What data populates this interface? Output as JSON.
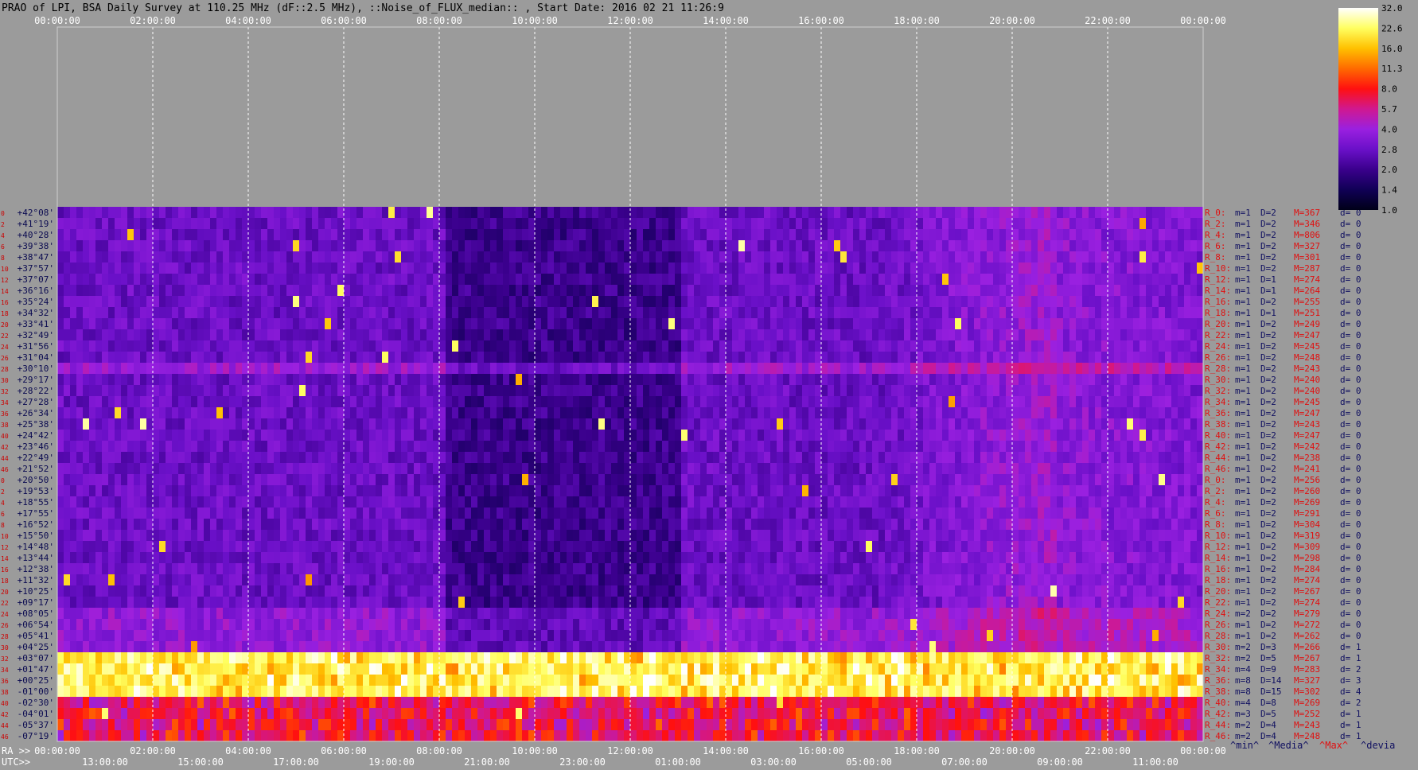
{
  "title": "PRAO of LPI, BSA Daily Survey at 110.25 MHz (dF::2.5 MHz), ::Noise_of_FLUX_median:: , Start Date: 2016 02 21 11:26:9",
  "colors": {
    "background": "#9b9b9b",
    "title_text": "#000000",
    "top_tick_text": "#ffffff",
    "dec_label_text": "#0a0a50",
    "row_index_text": "#cc0000",
    "stat_R": "#e01010",
    "stat_mD": "#101060",
    "stat_M": "#e01010",
    "stat_d": "#101060"
  },
  "chart_data": {
    "type": "heatmap",
    "title": "PRAO of LPI, BSA Daily Survey at 110.25 MHz (dF::2.5 MHz), ::Noise_of_FLUX_median:: , Start Date: 2016 02 21 11:26:9",
    "top_axis_ticks": [
      "00:00:00",
      "02:00:00",
      "04:00:00",
      "06:00:00",
      "08:00:00",
      "10:00:00",
      "12:00:00",
      "14:00:00",
      "16:00:00",
      "18:00:00",
      "20:00:00",
      "22:00:00",
      "00:00:00"
    ],
    "ra_axis_label": "RA >>",
    "ra_ticks": [
      "00:00:00",
      "02:00:00",
      "04:00:00",
      "06:00:00",
      "08:00:00",
      "10:00:00",
      "12:00:00",
      "14:00:00",
      "16:00:00",
      "18:00:00",
      "20:00:00",
      "22:00:00",
      "00:00:00"
    ],
    "utc_axis_label": "UTC>>",
    "utc_ticks": [
      "13:00:00",
      "15:00:00",
      "17:00:00",
      "19:00:00",
      "21:00:00",
      "23:00:00",
      "01:00:00",
      "03:00:00",
      "05:00:00",
      "07:00:00",
      "09:00:00",
      "11:00:00"
    ],
    "y_labels": [
      "+42°08'",
      "+41°19'",
      "+40°28'",
      "+39°38'",
      "+38°47'",
      "+37°57'",
      "+37°07'",
      "+36°16'",
      "+35°24'",
      "+34°32'",
      "+33°41'",
      "+32°49'",
      "+31°56'",
      "+31°04'",
      "+30°10'",
      "+29°17'",
      "+28°22'",
      "+27°28'",
      "+26°34'",
      "+25°38'",
      "+24°42'",
      "+23°46'",
      "+22°49'",
      "+21°52'",
      "+20°50'",
      "+19°53'",
      "+18°55'",
      "+17°55'",
      "+16°52'",
      "+15°50'",
      "+14°48'",
      "+13°44'",
      "+12°38'",
      "+11°32'",
      "+10°25'",
      "+09°17'",
      "+08°05'",
      "+06°54'",
      "+05°41'",
      "+04°25'",
      "+03°07'",
      "+01°47'",
      "+00°25'",
      "-01°00'",
      "-02°30'",
      "-04°01'",
      "-05°37'",
      "-07°19'"
    ],
    "row_indices": [
      "0",
      "2",
      "4",
      "6",
      "8",
      "10",
      "12",
      "14",
      "16",
      "18",
      "20",
      "22",
      "24",
      "26",
      "28",
      "30",
      "32",
      "34",
      "36",
      "38",
      "40",
      "42",
      "44",
      "46",
      "0",
      "2",
      "4",
      "6",
      "8",
      "10",
      "12",
      "14",
      "16",
      "18",
      "20",
      "22",
      "24",
      "26",
      "28",
      "30",
      "32",
      "34",
      "36",
      "38",
      "40",
      "42",
      "44",
      "46"
    ],
    "row_stats": [
      {
        "r": "R_0:",
        "m": "m=1",
        "D": "D=2",
        "M": "M=367",
        "d": "d= 0"
      },
      {
        "r": "R_2:",
        "m": "m=1",
        "D": "D=2",
        "M": "M=346",
        "d": "d= 0"
      },
      {
        "r": "R_4:",
        "m": "m=1",
        "D": "D=2",
        "M": "M=806",
        "d": "d= 0"
      },
      {
        "r": "R_6:",
        "m": "m=1",
        "D": "D=2",
        "M": "M=327",
        "d": "d= 0"
      },
      {
        "r": "R_8:",
        "m": "m=1",
        "D": "D=2",
        "M": "M=301",
        "d": "d= 0"
      },
      {
        "r": "R_10:",
        "m": "m=1",
        "D": "D=2",
        "M": "M=287",
        "d": "d= 0"
      },
      {
        "r": "R_12:",
        "m": "m=1",
        "D": "D=1",
        "M": "M=274",
        "d": "d= 0"
      },
      {
        "r": "R_14:",
        "m": "m=1",
        "D": "D=1",
        "M": "M=264",
        "d": "d= 0"
      },
      {
        "r": "R_16:",
        "m": "m=1",
        "D": "D=2",
        "M": "M=255",
        "d": "d= 0"
      },
      {
        "r": "R_18:",
        "m": "m=1",
        "D": "D=1",
        "M": "M=251",
        "d": "d= 0"
      },
      {
        "r": "R_20:",
        "m": "m=1",
        "D": "D=2",
        "M": "M=249",
        "d": "d= 0"
      },
      {
        "r": "R_22:",
        "m": "m=1",
        "D": "D=2",
        "M": "M=247",
        "d": "d= 0"
      },
      {
        "r": "R_24:",
        "m": "m=1",
        "D": "D=2",
        "M": "M=245",
        "d": "d= 0"
      },
      {
        "r": "R_26:",
        "m": "m=1",
        "D": "D=2",
        "M": "M=248",
        "d": "d= 0"
      },
      {
        "r": "R_28:",
        "m": "m=1",
        "D": "D=2",
        "M": "M=243",
        "d": "d= 0"
      },
      {
        "r": "R_30:",
        "m": "m=1",
        "D": "D=2",
        "M": "M=240",
        "d": "d= 0"
      },
      {
        "r": "R_32:",
        "m": "m=1",
        "D": "D=2",
        "M": "M=240",
        "d": "d= 0"
      },
      {
        "r": "R_34:",
        "m": "m=1",
        "D": "D=2",
        "M": "M=245",
        "d": "d= 0"
      },
      {
        "r": "R_36:",
        "m": "m=1",
        "D": "D=2",
        "M": "M=247",
        "d": "d= 0"
      },
      {
        "r": "R_38:",
        "m": "m=1",
        "D": "D=2",
        "M": "M=243",
        "d": "d= 0"
      },
      {
        "r": "R_40:",
        "m": "m=1",
        "D": "D=2",
        "M": "M=247",
        "d": "d= 0"
      },
      {
        "r": "R_42:",
        "m": "m=1",
        "D": "D=2",
        "M": "M=242",
        "d": "d= 0"
      },
      {
        "r": "R_44:",
        "m": "m=1",
        "D": "D=2",
        "M": "M=238",
        "d": "d= 0"
      },
      {
        "r": "R_46:",
        "m": "m=1",
        "D": "D=2",
        "M": "M=241",
        "d": "d= 0"
      },
      {
        "r": "R_0:",
        "m": "m=1",
        "D": "D=2",
        "M": "M=256",
        "d": "d= 0"
      },
      {
        "r": "R_2:",
        "m": "m=1",
        "D": "D=2",
        "M": "M=260",
        "d": "d= 0"
      },
      {
        "r": "R_4:",
        "m": "m=1",
        "D": "D=2",
        "M": "M=269",
        "d": "d= 0"
      },
      {
        "r": "R_6:",
        "m": "m=1",
        "D": "D=2",
        "M": "M=291",
        "d": "d= 0"
      },
      {
        "r": "R_8:",
        "m": "m=1",
        "D": "D=2",
        "M": "M=304",
        "d": "d= 0"
      },
      {
        "r": "R_10:",
        "m": "m=1",
        "D": "D=2",
        "M": "M=319",
        "d": "d= 0"
      },
      {
        "r": "R_12:",
        "m": "m=1",
        "D": "D=2",
        "M": "M=309",
        "d": "d= 0"
      },
      {
        "r": "R_14:",
        "m": "m=1",
        "D": "D=2",
        "M": "M=298",
        "d": "d= 0"
      },
      {
        "r": "R_16:",
        "m": "m=1",
        "D": "D=2",
        "M": "M=284",
        "d": "d= 0"
      },
      {
        "r": "R_18:",
        "m": "m=1",
        "D": "D=2",
        "M": "M=274",
        "d": "d= 0"
      },
      {
        "r": "R_20:",
        "m": "m=1",
        "D": "D=2",
        "M": "M=267",
        "d": "d= 0"
      },
      {
        "r": "R_22:",
        "m": "m=1",
        "D": "D=2",
        "M": "M=274",
        "d": "d= 0"
      },
      {
        "r": "R_24:",
        "m": "m=2",
        "D": "D=2",
        "M": "M=279",
        "d": "d= 0"
      },
      {
        "r": "R_26:",
        "m": "m=1",
        "D": "D=2",
        "M": "M=272",
        "d": "d= 0"
      },
      {
        "r": "R_28:",
        "m": "m=1",
        "D": "D=2",
        "M": "M=262",
        "d": "d= 0"
      },
      {
        "r": "R_30:",
        "m": "m=2",
        "D": "D=3",
        "M": "M=266",
        "d": "d= 1"
      },
      {
        "r": "R_32:",
        "m": "m=2",
        "D": "D=5",
        "M": "M=267",
        "d": "d= 1"
      },
      {
        "r": "R_34:",
        "m": "m=4",
        "D": "D=9",
        "M": "M=283",
        "d": "d= 2"
      },
      {
        "r": "R_36:",
        "m": "m=8",
        "D": "D=14",
        "M": "M=327",
        "d": "d= 3"
      },
      {
        "r": "R_38:",
        "m": "m=8",
        "D": "D=15",
        "M": "M=302",
        "d": "d= 4"
      },
      {
        "r": "R_40:",
        "m": "m=4",
        "D": "D=8",
        "M": "M=269",
        "d": "d= 2"
      },
      {
        "r": "R_42:",
        "m": "m=3",
        "D": "D=5",
        "M": "M=252",
        "d": "d= 1"
      },
      {
        "r": "R_44:",
        "m": "m=2",
        "D": "D=4",
        "M": "M=243",
        "d": "d= 1"
      },
      {
        "r": "R_46:",
        "m": "m=2",
        "D": "D=4",
        "M": "M=248",
        "d": "d= 1"
      }
    ],
    "legend_footer": {
      "min": "^min^",
      "median": "^Media^",
      "max": "^Max^",
      "dev": "^devia"
    },
    "colorbar_ticks": [
      "32.0",
      "22.6",
      "16.0",
      "11.3",
      "8.0",
      "5.7",
      "4.0",
      "2.8",
      "2.0",
      "1.4",
      "1.0"
    ],
    "colorscale": [
      "#000018",
      "#100055",
      "#3a008c",
      "#6a10c8",
      "#9a20e0",
      "#d01890",
      "#ff1010",
      "#ff6a00",
      "#ffc000",
      "#ffff60",
      "#ffffff"
    ]
  }
}
